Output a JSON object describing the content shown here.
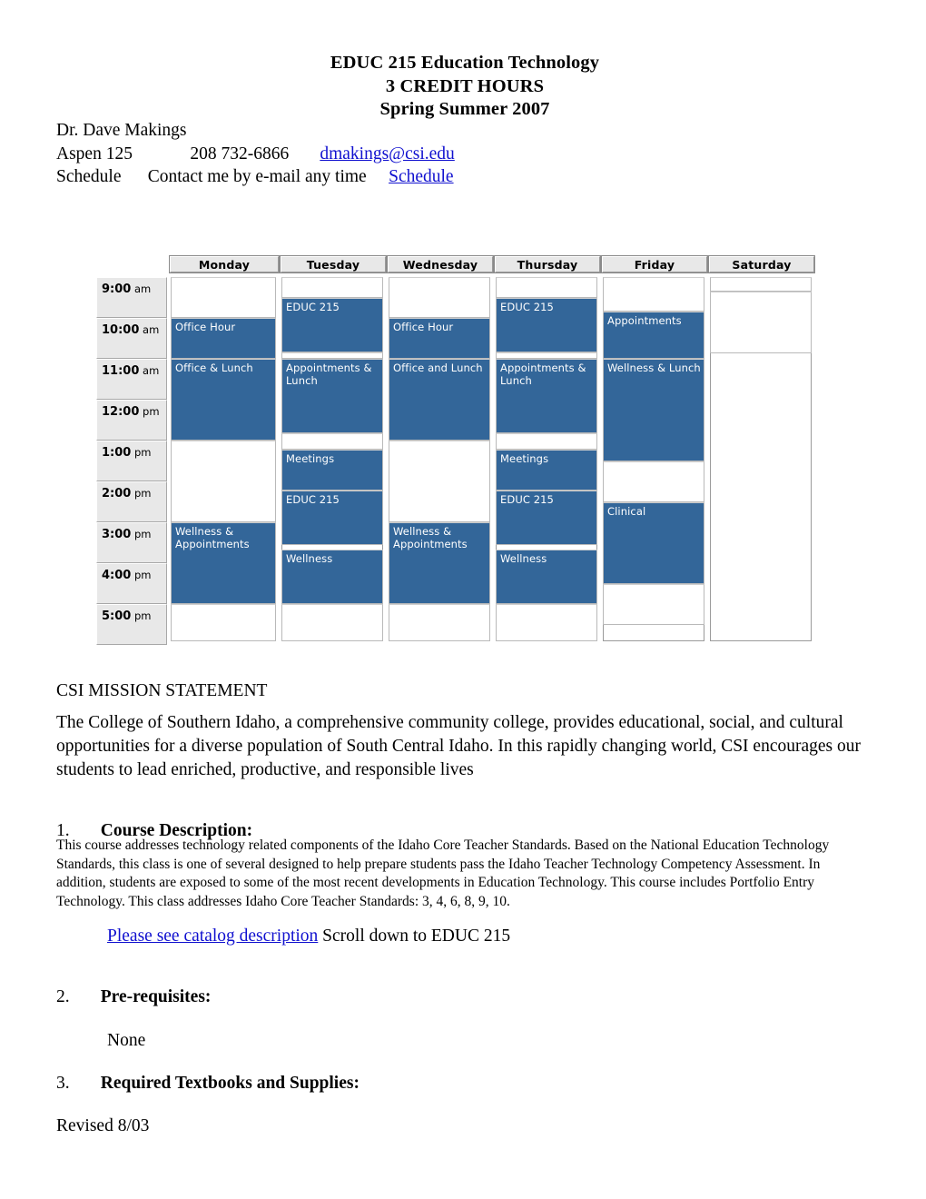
{
  "header": {
    "line1": "EDUC 215 Education Technology",
    "line2": "3 CREDIT HOURS",
    "line3": "Spring Summer 2007"
  },
  "contact": {
    "instructor": "Dr. Dave Makings",
    "office": "Aspen 125",
    "phone": "208 732-6866",
    "email": "dmakings@csi.edu",
    "schedule_label": "Schedule",
    "schedule_note": "Contact me by e-mail any time",
    "schedule_link": "Schedule"
  },
  "link_color": "#1010cf",
  "schedule": {
    "busy_color": "#336699",
    "header_bg": "#e8e8e8",
    "days": [
      "Monday",
      "Tuesday",
      "Wednesday",
      "Thursday",
      "Friday",
      "Saturday"
    ],
    "times": [
      {
        "hour": "9:00",
        "meridiem": "am"
      },
      {
        "hour": "10:00",
        "meridiem": "am"
      },
      {
        "hour": "11:00",
        "meridiem": "am"
      },
      {
        "hour": "12:00",
        "meridiem": "pm"
      },
      {
        "hour": "1:00",
        "meridiem": "pm"
      },
      {
        "hour": "2:00",
        "meridiem": "pm"
      },
      {
        "hour": "3:00",
        "meridiem": "pm"
      },
      {
        "hour": "4:00",
        "meridiem": "pm"
      },
      {
        "hour": "5:00",
        "meridiem": "pm"
      }
    ],
    "columns": [
      {
        "day": "Monday",
        "events": [
          {
            "label": "",
            "start": 0,
            "end": 45,
            "busy": false
          },
          {
            "label": "Office Hour",
            "start": 45,
            "end": 90,
            "busy": true
          },
          {
            "label": "Office & Lunch",
            "start": 90,
            "end": 180,
            "busy": true
          },
          {
            "label": "",
            "start": 180,
            "end": 270,
            "busy": false
          },
          {
            "label": "Wellness & Appointments",
            "start": 270,
            "end": 360,
            "busy": true
          },
          {
            "label": "",
            "start": 360,
            "end": 401,
            "busy": false
          }
        ]
      },
      {
        "day": "Tuesday",
        "events": [
          {
            "label": "",
            "start": 0,
            "end": 23,
            "busy": false
          },
          {
            "label": "EDUC 215",
            "start": 23,
            "end": 83,
            "busy": true
          },
          {
            "label": "",
            "start": 83,
            "end": 90,
            "busy": false
          },
          {
            "label": "Appointments & Lunch",
            "start": 90,
            "end": 172,
            "busy": true
          },
          {
            "label": "",
            "start": 172,
            "end": 190,
            "busy": false
          },
          {
            "label": "Meetings",
            "start": 190,
            "end": 235,
            "busy": true
          },
          {
            "label": "EDUC 215",
            "start": 235,
            "end": 295,
            "busy": true
          },
          {
            "label": "Wellness",
            "start": 300,
            "end": 360,
            "busy": true
          },
          {
            "label": "",
            "start": 360,
            "end": 401,
            "busy": false
          }
        ]
      },
      {
        "day": "Wednesday",
        "events": [
          {
            "label": "",
            "start": 0,
            "end": 45,
            "busy": false
          },
          {
            "label": "Office Hour",
            "start": 45,
            "end": 90,
            "busy": true
          },
          {
            "label": "Office and Lunch",
            "start": 90,
            "end": 180,
            "busy": true
          },
          {
            "label": "",
            "start": 180,
            "end": 270,
            "busy": false
          },
          {
            "label": "Wellness & Appointments",
            "start": 270,
            "end": 360,
            "busy": true
          },
          {
            "label": "",
            "start": 360,
            "end": 401,
            "busy": false
          }
        ]
      },
      {
        "day": "Thursday",
        "events": [
          {
            "label": "",
            "start": 0,
            "end": 23,
            "busy": false
          },
          {
            "label": "EDUC 215",
            "start": 23,
            "end": 83,
            "busy": true
          },
          {
            "label": "",
            "start": 83,
            "end": 90,
            "busy": false
          },
          {
            "label": "Appointments & Lunch",
            "start": 90,
            "end": 172,
            "busy": true
          },
          {
            "label": "",
            "start": 172,
            "end": 190,
            "busy": false
          },
          {
            "label": "Meetings",
            "start": 190,
            "end": 235,
            "busy": true
          },
          {
            "label": "EDUC 215",
            "start": 235,
            "end": 295,
            "busy": true
          },
          {
            "label": "Wellness",
            "start": 300,
            "end": 360,
            "busy": true
          },
          {
            "label": "",
            "start": 360,
            "end": 401,
            "busy": false
          }
        ]
      },
      {
        "day": "Friday",
        "events": [
          {
            "label": "",
            "start": 0,
            "end": 38,
            "busy": false
          },
          {
            "label": "Appointments",
            "start": 38,
            "end": 90,
            "busy": true
          },
          {
            "label": "Wellness & Lunch",
            "start": 90,
            "end": 203,
            "busy": true
          },
          {
            "label": "",
            "start": 203,
            "end": 248,
            "busy": false
          },
          {
            "label": "Clinical",
            "start": 248,
            "end": 338,
            "busy": true
          },
          {
            "label": "",
            "start": 338,
            "end": 383,
            "busy": false
          }
        ]
      },
      {
        "day": "Saturday",
        "events": [
          {
            "label": "",
            "start": 0,
            "end": 16,
            "busy": false
          },
          {
            "label": "",
            "start": 16,
            "end": 84,
            "busy": false
          }
        ]
      }
    ]
  },
  "mission": {
    "title": "CSI MISSION STATEMENT",
    "body": "The College of Southern Idaho, a comprehensive community college, provides educational, social, and cultural opportunities for a diverse population of South Central Idaho. In this rapidly changing world, CSI encourages our students to lead enriched, productive, and responsible lives"
  },
  "sections": {
    "s1_num": "1.",
    "s1_title": "Course Description:",
    "s1_body": "This course addresses technology related components of the Idaho Core Teacher Standards.  Based on the National Education Technology Standards, this class is one of several designed to help prepare students pass the Idaho Teacher Technology Competency Assessment.  In addition, students are exposed to some of the most recent developments in Education Technology.  This course includes Portfolio Entry Technology. This class addresses Idaho Core Teacher Standards: 3, 4, 6, 8, 9, 10.",
    "catalog_link": "Please see catalog description",
    "catalog_after": " Scroll down to EDUC 215",
    "s2_num": "2.",
    "s2_title": "Pre-requisites:",
    "s2_body": "None",
    "s3_num": "3.",
    "s3_title": "Required Textbooks and Supplies:"
  },
  "footer": {
    "revised": "Revised 8/03"
  }
}
